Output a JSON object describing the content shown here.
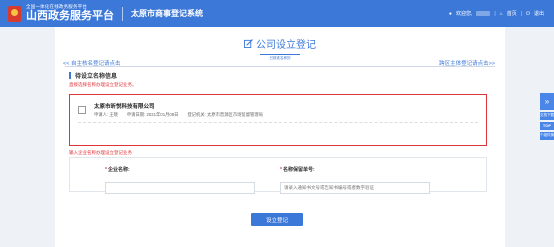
{
  "header": {
    "platform_subtitle": "全国一体化在线政务服务平台",
    "platform_title": "山西政务服务平台",
    "system_title": "太原市商事登记系统",
    "welcome": "欢迎您,",
    "home": "首页",
    "logout": "退出",
    "colors": {
      "bar": "#3c78d8",
      "emblem": "#d83a2e"
    }
  },
  "page": {
    "title": "公司设立登记",
    "subtitle": "已核准名称的",
    "link_left": "<< 自主核名登记请点击",
    "link_right": "跨区主体登记请点击>>"
  },
  "section": {
    "title": "待设立名称信息",
    "hint_select": "直接选择名称办理设立登记业务。",
    "hint_input": "输入企业名称办理设立登记业务"
  },
  "candidate": {
    "name": "太原市昕悦科技有限公司",
    "applicant": "申请人: 王晓",
    "apply_date": "申请日期: 2021年01月08日",
    "authority": "登记机关: 太原市晋源区市场监督管理局"
  },
  "form": {
    "company_name_label": "企业名称:",
    "company_name_value": "",
    "reserve_no_label": "名称保留单号:",
    "reserve_no_placeholder": "请录入通知书文号或告知书编号或者数字验证"
  },
  "submit_label": "设立登记",
  "side": {
    "tab_1": "文档下载",
    "tab_top": "TOP",
    "tab_2": "个组件换"
  }
}
